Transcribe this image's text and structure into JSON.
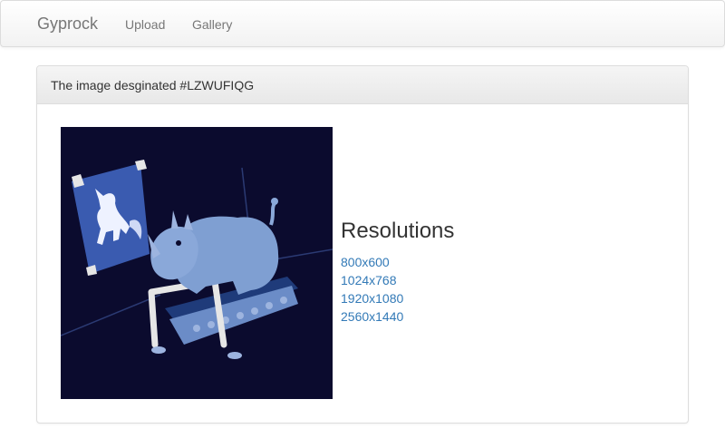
{
  "navbar": {
    "brand": "Gyprock",
    "links": [
      {
        "label": "Upload"
      },
      {
        "label": "Gallery"
      }
    ]
  },
  "panel": {
    "heading": "The image desginated #LZWUFIQG"
  },
  "resolutions": {
    "title": "Resolutions",
    "items": [
      "800x600",
      "1024x768",
      "1920x1080",
      "2560x1440"
    ]
  },
  "colors": {
    "link": "#337ab7",
    "image_background": "#0b0b2e",
    "rhino": "#7f9fd2"
  }
}
